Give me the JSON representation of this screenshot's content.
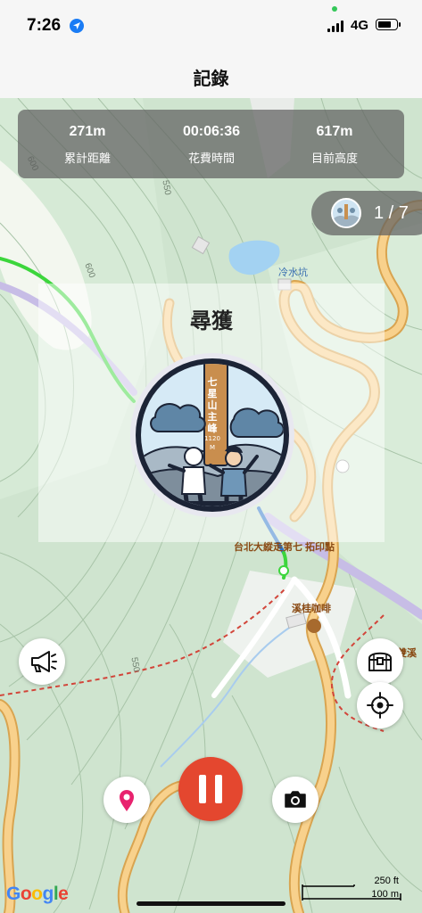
{
  "status_bar": {
    "time": "7:26",
    "network": "4G",
    "battery_level": 0.75
  },
  "header": {
    "title": "記錄"
  },
  "stats": [
    {
      "value": "271m",
      "label": "累計距離"
    },
    {
      "value": "00:06:36",
      "label": "花費時間"
    },
    {
      "value": "617m",
      "label": "目前高度"
    }
  ],
  "progress": {
    "count": "1 / 7"
  },
  "found_panel": {
    "title": "尋獲",
    "badge": {
      "mountain": "七星山主峰",
      "elevation": "1120",
      "unit": "M"
    }
  },
  "map_labels": {
    "contour_600_top": "600",
    "contour_550_top": "550",
    "contour_600_left": "600",
    "contour_550_bottom": "550",
    "lake": "冷水坑",
    "stamp_point": "台北大縱走第七 拓印點",
    "cafe": "溪桂咖啡",
    "edge_label": "雙溪"
  },
  "icons": [
    "location-arrow-icon",
    "megaphone-icon",
    "treasure-chest-icon",
    "crosshair-icon",
    "map-pin-icon",
    "pause-icon",
    "camera-icon"
  ],
  "map_attribution": "Google",
  "scale_bar": {
    "feet": "250 ft",
    "meters": "100 m"
  },
  "colors": {
    "pause": "#e4472f",
    "pin": "#e8226e",
    "route_green": "#3cd63c",
    "road": "#f5c67a"
  }
}
